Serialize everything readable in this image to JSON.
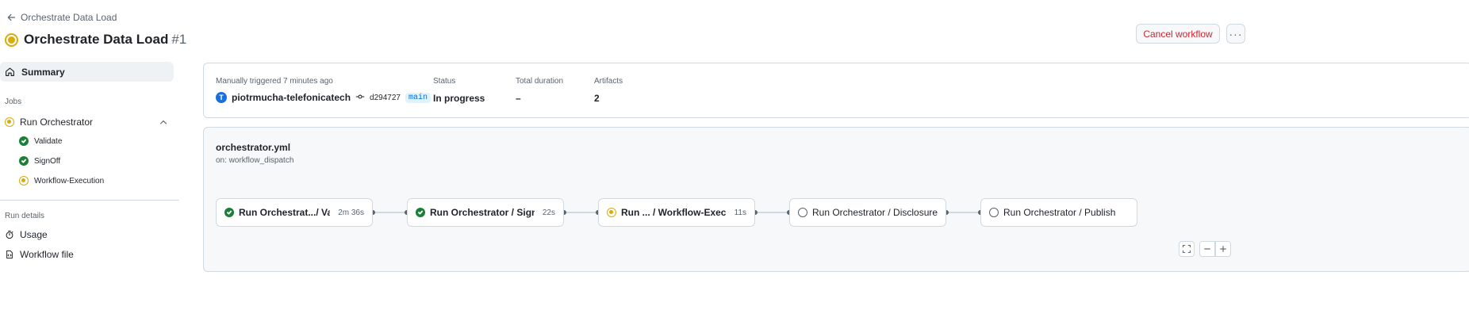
{
  "header": {
    "back_label": "Orchestrate Data Load",
    "title": "Orchestrate Data Load",
    "run_number": "#1",
    "cancel_label": "Cancel workflow",
    "more_label": "···"
  },
  "sidebar": {
    "summary_label": "Summary",
    "jobs_heading": "Jobs",
    "jobs": [
      {
        "label": "Run Orchestrator",
        "status": "in-progress"
      },
      {
        "label": "Validate",
        "status": "success"
      },
      {
        "label": "SignOff",
        "status": "success"
      },
      {
        "label": "Workflow-Execution",
        "status": "in-progress"
      }
    ],
    "run_details_heading": "Run details",
    "details": [
      {
        "label": "Usage",
        "icon": "stopwatch-icon"
      },
      {
        "label": "Workflow file",
        "icon": "file-code-icon"
      }
    ]
  },
  "summary": {
    "trigger_text": "Manually triggered 7 minutes ago",
    "avatar_letter": "T",
    "actor": "piotrmucha-telefonicatech",
    "commit_sha": "d294727",
    "branch": "main",
    "status_label": "Status",
    "status_value": "In progress",
    "duration_label": "Total duration",
    "duration_value": "–",
    "artifacts_label": "Artifacts",
    "artifacts_value": "2"
  },
  "graph": {
    "file_name": "orchestrator.yml",
    "trigger": "on: workflow_dispatch",
    "nodes": [
      {
        "name": "Run Orchestrat.../ Validate",
        "duration": "2m 36s",
        "status": "success"
      },
      {
        "name": "Run Orchestrator / SignOff",
        "duration": "22s",
        "status": "success"
      },
      {
        "name": "Run ...  / Workflow-Execution",
        "duration": "11s",
        "status": "in-progress"
      },
      {
        "name": "Run Orchestrator / Disclosure",
        "duration": "",
        "status": "pending"
      },
      {
        "name": "Run Orchestrator / Publish",
        "duration": "",
        "status": "pending"
      }
    ]
  },
  "colors": {
    "success": "#1a7f37",
    "in_progress": "#dbab0a",
    "danger": "#d1242f",
    "link": "#0969da"
  }
}
